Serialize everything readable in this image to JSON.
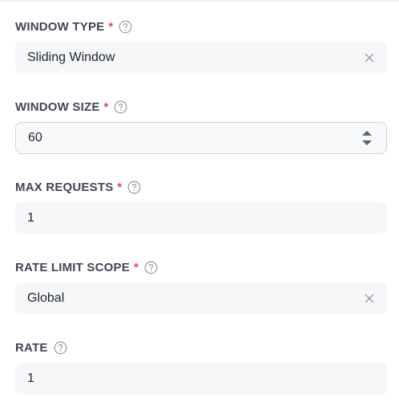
{
  "fields": {
    "window_type": {
      "label": "WINDOW TYPE",
      "required_mark": "*",
      "value": "Sliding Window",
      "control": "select",
      "clearable": true
    },
    "window_size": {
      "label": "WINDOW SIZE",
      "required_mark": "*",
      "value": "60",
      "control": "number-stepper"
    },
    "max_requests": {
      "label": "MAX REQUESTS",
      "required_mark": "*",
      "value": "1",
      "control": "number"
    },
    "rate_limit_scope": {
      "label": "RATE LIMIT SCOPE",
      "required_mark": "*",
      "value": "Global",
      "control": "select",
      "clearable": true
    },
    "rate": {
      "label": "RATE",
      "value": "1",
      "control": "number"
    }
  },
  "icons": {
    "help": "question-circle-icon",
    "clear": "close-icon",
    "stepper_up": "caret-up-icon",
    "stepper_down": "caret-down-icon"
  },
  "colors": {
    "required": "#e5484d",
    "label": "#3f4654",
    "input_bg": "#f6f7f9",
    "focused_border": "#cfd3da",
    "icon": "#9aa1ad"
  }
}
